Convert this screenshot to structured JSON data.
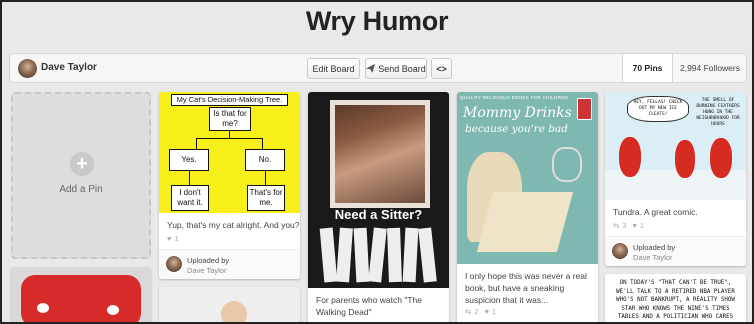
{
  "board": {
    "title": "Wry Humor"
  },
  "toolbar": {
    "user_name": "Dave Taylor",
    "edit_label": "Edit Board",
    "send_label": "Send Board",
    "embed_icon": "<>",
    "pins_label": "70 Pins",
    "followers_label": "2,994 Followers"
  },
  "add_pin": {
    "label": "Add a Pin",
    "icon": "plus-icon"
  },
  "pins": [
    {
      "image_text": {
        "title": "My Cat's Decision-Making Tree.",
        "q": "Is that for me?",
        "yes": "Yes.",
        "no": "No.",
        "left": "I don't want it.",
        "right": "That's for me."
      },
      "description": "Yup, that's my cat alright. And you?",
      "likes": "1",
      "uploaded_label": "Uploaded by",
      "uploader": "Dave Taylor"
    },
    {
      "image_text": {
        "caption": "Need a Sitter?"
      },
      "description": "For parents who watch \"The Walking Dead\""
    },
    {
      "image_text": {
        "top": "QUALITY RELIGIOUS BOOKS FOR CHILDREN",
        "title1": "Mommy Drinks",
        "title2": "because you're bad"
      },
      "description": "I only hope this was never a real book, but have a sneaking suspicion that it was...",
      "repins": "2",
      "likes": "1"
    },
    {
      "image_text": {
        "bubble1": "HEY, FELLAS! CHECK OUT MY NEW ICE CLEATS!",
        "bubble2": "THE SMELL OF BURNING FEATHERS HUNG IN THE NEIGHBORHOOD FOR HOURS"
      },
      "description": "Tundra. A great comic.",
      "repins": "3",
      "likes": "1",
      "uploaded_label": "Uploaded by",
      "uploader": "Dave Taylor"
    },
    {
      "image_text": {
        "comic": "ON TODAY'S \"THAT CAN'T BE TRUE\", WE'LL TALK TO A RETIRED NBA PLAYER WHO'S NOT BANKRUPT, A REALITY SHOW STAR WHO KNOWS THE NINE'S TIMES TABLES AND A POLITICIAN WHO CARES"
      }
    }
  ],
  "colors": {
    "accent_red": "#cb2027",
    "bg": "#e9e9e9"
  }
}
